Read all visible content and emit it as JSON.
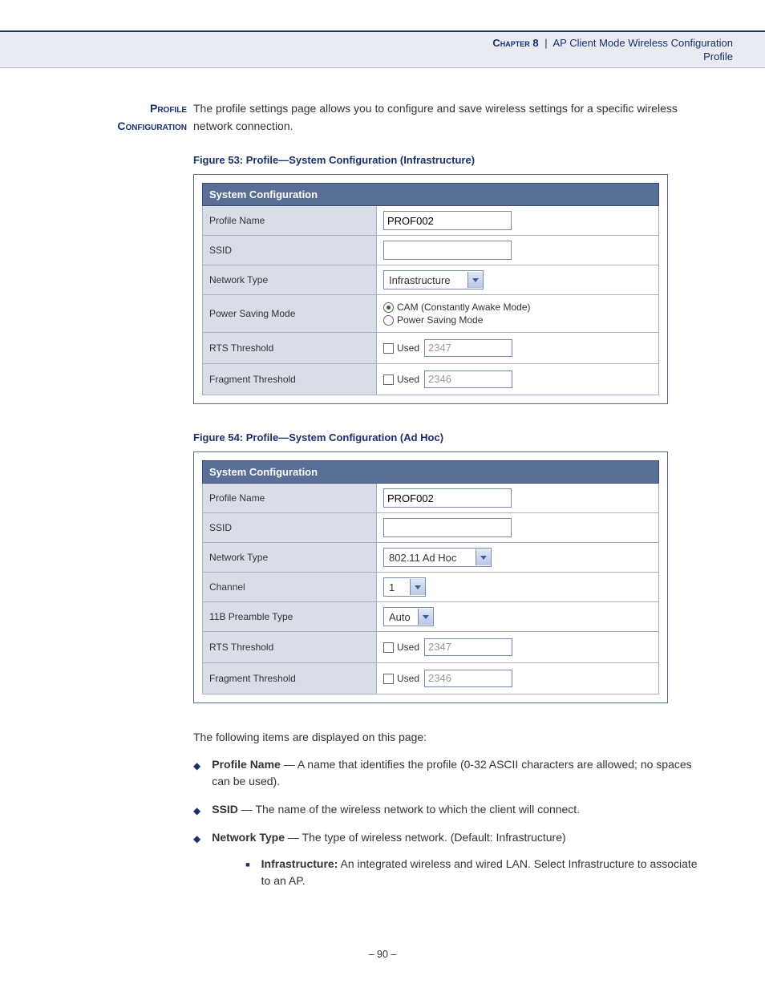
{
  "header": {
    "chapter": "Chapter 8",
    "separator": "|",
    "title": "AP Client Mode Wireless Configuration",
    "subtitle": "Profile"
  },
  "section": {
    "sideLabelLine1": "Profile",
    "sideLabelLine2": "Configuration",
    "intro": "The profile settings page allows you to configure and save wireless settings for a specific wireless network connection."
  },
  "figure53": {
    "caption": "Figure 53:  Profile—System Configuration (Infrastructure)",
    "title": "System Configuration",
    "rows": {
      "profileName": {
        "label": "Profile Name",
        "value": "PROF002"
      },
      "ssid": {
        "label": "SSID",
        "value": ""
      },
      "networkType": {
        "label": "Network Type",
        "value": "Infrastructure"
      },
      "powerSaving": {
        "label": "Power Saving Mode",
        "opt1": "CAM (Constantly Awake Mode)",
        "opt2": "Power Saving Mode"
      },
      "rts": {
        "label": "RTS Threshold",
        "usedLabel": "Used",
        "value": "2347"
      },
      "fragment": {
        "label": "Fragment Threshold",
        "usedLabel": "Used",
        "value": "2346"
      }
    }
  },
  "figure54": {
    "caption": "Figure 54:  Profile—System Configuration (Ad Hoc)",
    "title": "System Configuration",
    "rows": {
      "profileName": {
        "label": "Profile Name",
        "value": "PROF002"
      },
      "ssid": {
        "label": "SSID",
        "value": ""
      },
      "networkType": {
        "label": "Network Type",
        "value": "802.11 Ad Hoc"
      },
      "channel": {
        "label": "Channel",
        "value": "1"
      },
      "preamble": {
        "label": "11B Preamble Type",
        "value": "Auto"
      },
      "rts": {
        "label": "RTS Threshold",
        "usedLabel": "Used",
        "value": "2347"
      },
      "fragment": {
        "label": "Fragment Threshold",
        "usedLabel": "Used",
        "value": "2346"
      }
    }
  },
  "items": {
    "intro": "The following items are displayed on this page:",
    "profileName": {
      "term": "Profile Name",
      "desc": " — A name that identifies the profile (0-32 ASCII characters are allowed; no spaces can be used)."
    },
    "ssid": {
      "term": "SSID",
      "desc": " — The name of the wireless network to which the client will connect."
    },
    "networkType": {
      "term": "Network Type",
      "desc": " — The type of wireless network. (Default: Infrastructure)",
      "sub": {
        "term": "Infrastructure:",
        "desc": " An integrated wireless and wired LAN. Select Infrastructure to associate to an AP."
      }
    }
  },
  "pageNumber": "–  90  –"
}
